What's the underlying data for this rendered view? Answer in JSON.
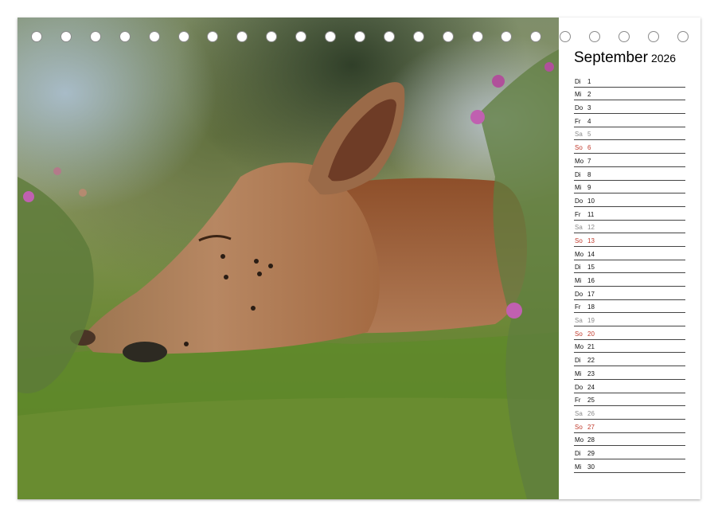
{
  "calendar": {
    "month": "September",
    "year": "2026",
    "days": [
      {
        "wd": "Di",
        "d": "1",
        "type": "weekday"
      },
      {
        "wd": "Mi",
        "d": "2",
        "type": "weekday"
      },
      {
        "wd": "Do",
        "d": "3",
        "type": "weekday"
      },
      {
        "wd": "Fr",
        "d": "4",
        "type": "weekday"
      },
      {
        "wd": "Sa",
        "d": "5",
        "type": "saturday"
      },
      {
        "wd": "So",
        "d": "6",
        "type": "sunday"
      },
      {
        "wd": "Mo",
        "d": "7",
        "type": "weekday"
      },
      {
        "wd": "Di",
        "d": "8",
        "type": "weekday"
      },
      {
        "wd": "Mi",
        "d": "9",
        "type": "weekday"
      },
      {
        "wd": "Do",
        "d": "10",
        "type": "weekday"
      },
      {
        "wd": "Fr",
        "d": "11",
        "type": "weekday"
      },
      {
        "wd": "Sa",
        "d": "12",
        "type": "saturday"
      },
      {
        "wd": "So",
        "d": "13",
        "type": "sunday"
      },
      {
        "wd": "Mo",
        "d": "14",
        "type": "weekday"
      },
      {
        "wd": "Di",
        "d": "15",
        "type": "weekday"
      },
      {
        "wd": "Mi",
        "d": "16",
        "type": "weekday"
      },
      {
        "wd": "Do",
        "d": "17",
        "type": "weekday"
      },
      {
        "wd": "Fr",
        "d": "18",
        "type": "weekday"
      },
      {
        "wd": "Sa",
        "d": "19",
        "type": "saturday"
      },
      {
        "wd": "So",
        "d": "20",
        "type": "sunday"
      },
      {
        "wd": "Mo",
        "d": "21",
        "type": "weekday"
      },
      {
        "wd": "Di",
        "d": "22",
        "type": "weekday"
      },
      {
        "wd": "Mi",
        "d": "23",
        "type": "weekday"
      },
      {
        "wd": "Do",
        "d": "24",
        "type": "weekday"
      },
      {
        "wd": "Fr",
        "d": "25",
        "type": "weekday"
      },
      {
        "wd": "Sa",
        "d": "26",
        "type": "saturday"
      },
      {
        "wd": "So",
        "d": "27",
        "type": "sunday"
      },
      {
        "wd": "Mo",
        "d": "28",
        "type": "weekday"
      },
      {
        "wd": "Di",
        "d": "29",
        "type": "weekday"
      },
      {
        "wd": "Mi",
        "d": "30",
        "type": "weekday"
      }
    ]
  },
  "binding": {
    "ring_count": 23
  },
  "colors": {
    "sunday": "#c0392b",
    "saturday": "#8a8a8a",
    "text": "#111111"
  }
}
